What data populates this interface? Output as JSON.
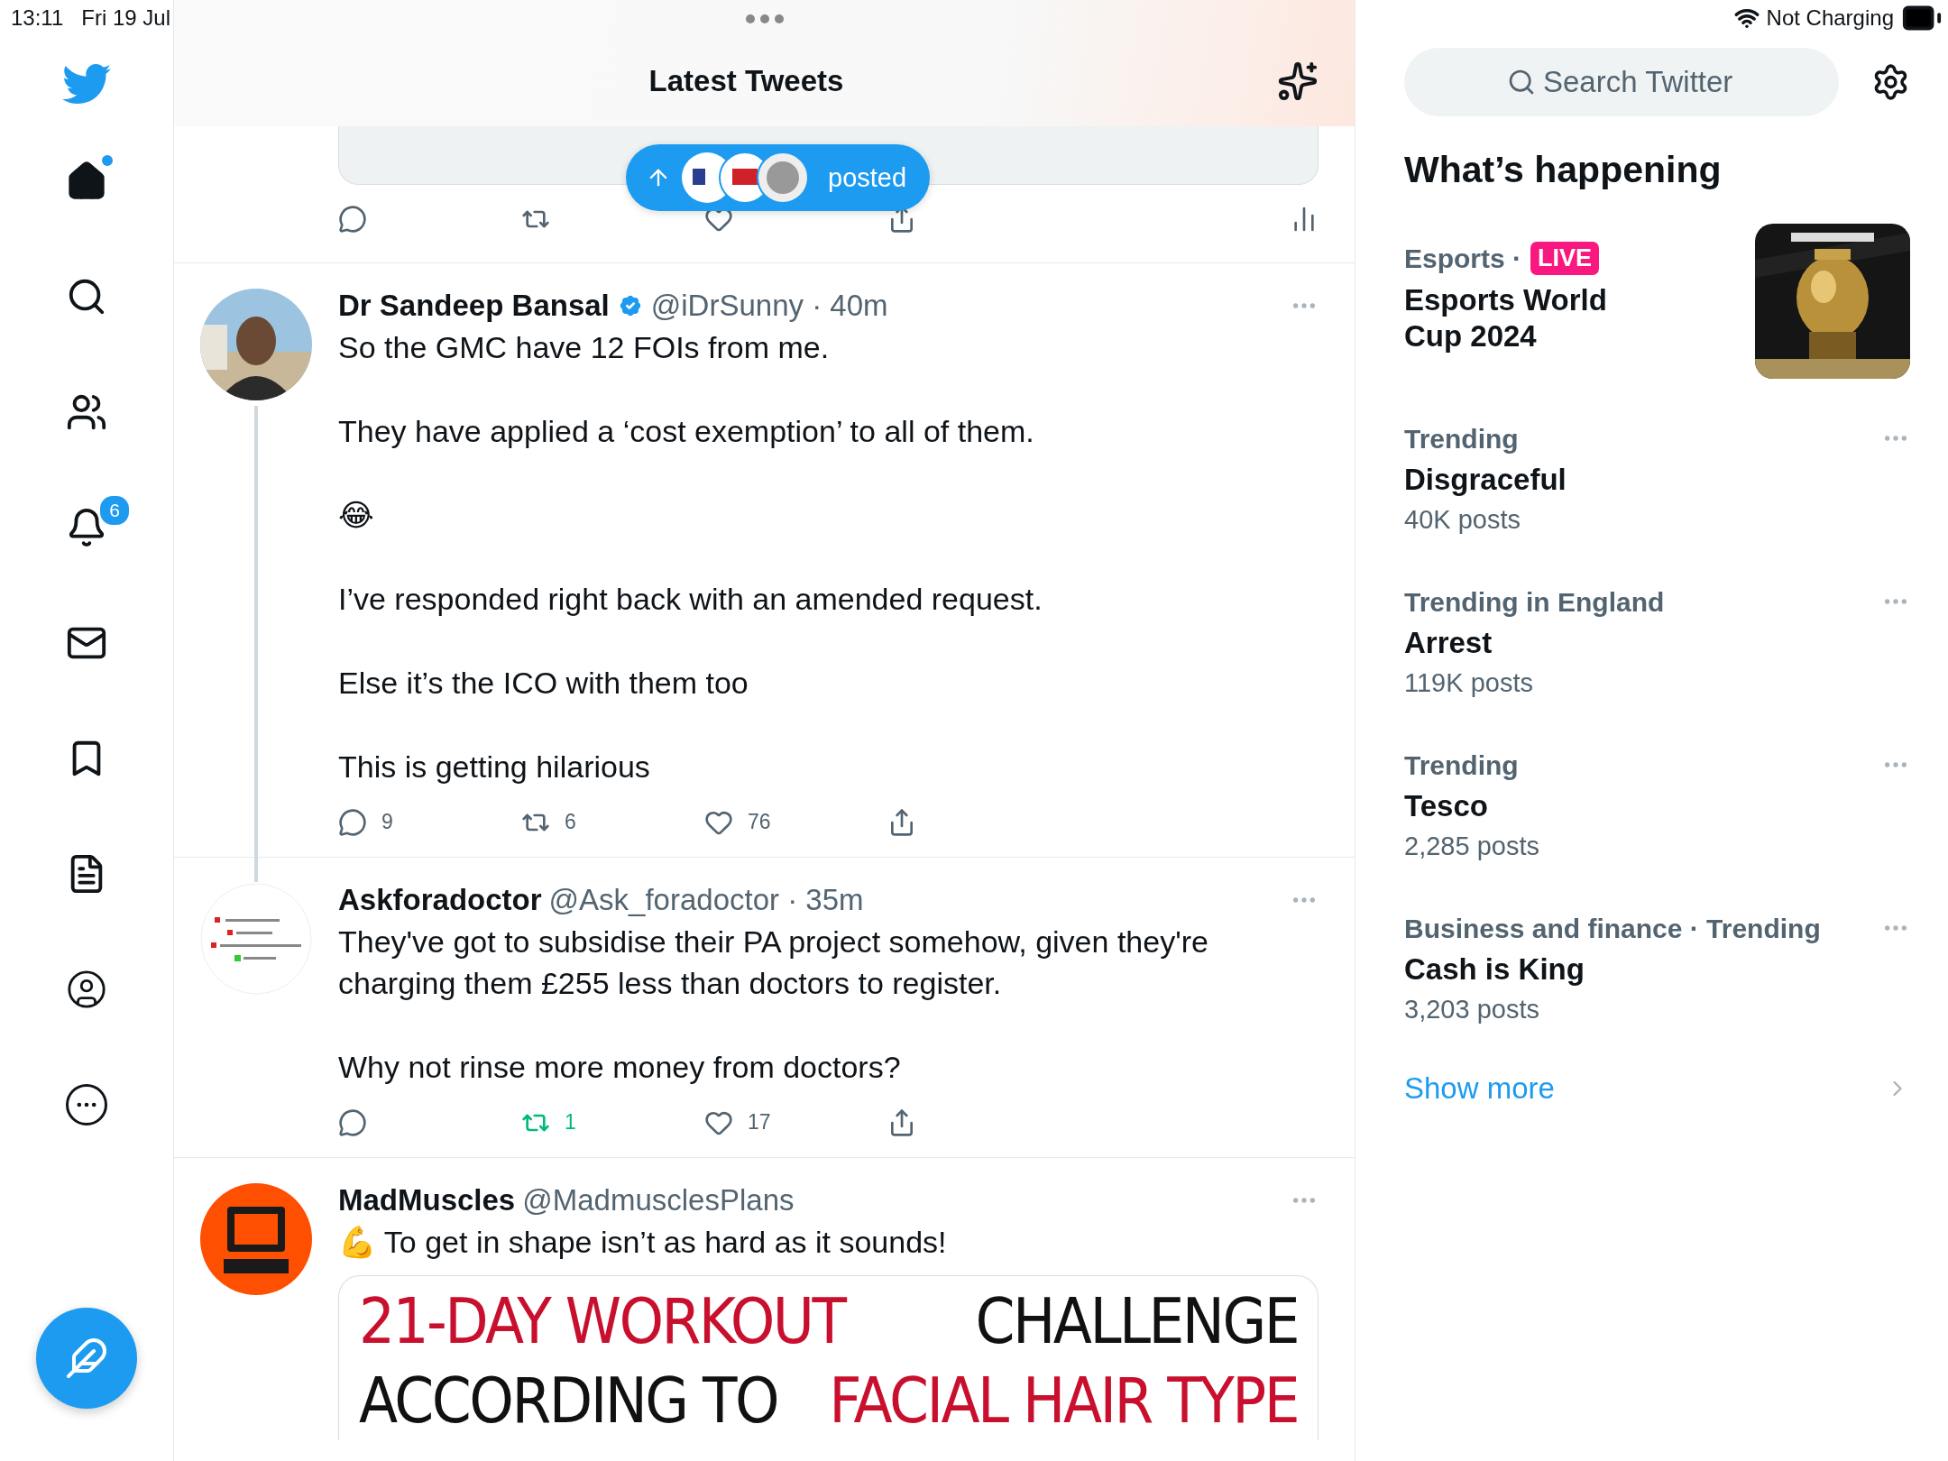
{
  "status_bar": {
    "time": "13:11",
    "date": "Fri 19 Jul",
    "charging": "Not Charging"
  },
  "sidebar": {
    "items": [
      {
        "kind": "home",
        "selected": true,
        "dot": true
      },
      {
        "kind": "search",
        "selected": false
      },
      {
        "kind": "communities",
        "selected": false
      },
      {
        "kind": "notifications",
        "selected": false,
        "badge": "6"
      },
      {
        "kind": "messages",
        "selected": false
      },
      {
        "kind": "bookmarks",
        "selected": false
      },
      {
        "kind": "lists",
        "selected": false
      },
      {
        "kind": "profile",
        "selected": false
      },
      {
        "kind": "more",
        "selected": false
      }
    ]
  },
  "header": {
    "title": "Latest Tweets"
  },
  "new_posts_pill": {
    "label": "posted"
  },
  "previous_tweet": {
    "actions": [
      {
        "kind": "reply"
      },
      {
        "kind": "retweet"
      },
      {
        "kind": "like"
      },
      {
        "kind": "share"
      },
      {
        "kind": "views"
      }
    ]
  },
  "tweets": [
    {
      "kind": "person",
      "name": "Dr Sandeep Bansal",
      "verified": true,
      "handle": "@iDrSunny · 40m",
      "thread": true,
      "text": "So the GMC have 12 FOIs from me.\n\nThey have applied a ‘cost exemption’ to all of them.\n\n😂\n\nI’ve responded right back with an amended request.\n\nElse it’s the ICO with them too\n\nThis is getting hilarious",
      "actions": [
        {
          "kind": "reply",
          "count": "9",
          "active": false
        },
        {
          "kind": "retweet",
          "count": "6",
          "active": false
        },
        {
          "kind": "like",
          "count": "76",
          "active": false
        },
        {
          "kind": "share",
          "active": false
        }
      ]
    },
    {
      "kind": "badge",
      "name": "Askforadoctor",
      "verified": false,
      "handle": "@Ask_foradoctor · 35m",
      "thread": false,
      "text": "They've got to subsidise their PA project somehow, given they're charging them £255 less than doctors to register.\n\nWhy not rinse more money from doctors?",
      "actions": [
        {
          "kind": "reply",
          "active": false
        },
        {
          "kind": "retweet",
          "count": "1",
          "active": true
        },
        {
          "kind": "like",
          "count": "17",
          "active": false
        },
        {
          "kind": "share",
          "active": false
        }
      ]
    },
    {
      "kind": "logo",
      "name": "MadMuscles",
      "verified": false,
      "handle": "@MadmusclesPlans",
      "thread": false,
      "text": "💪 To get in shape isn’t as hard as it sounds!",
      "media_lines": [
        [
          {
            "text": "21-DAY WORKOUT",
            "accent": true
          },
          {
            "text": "CHALLENGE",
            "accent": false
          }
        ],
        [
          {
            "text": "ACCORDING TO",
            "accent": false
          },
          {
            "text": "FACIAL HAIR TYPE",
            "accent": true
          }
        ]
      ]
    }
  ],
  "search": {
    "placeholder": "Search Twitter"
  },
  "trends_title": "What’s happening",
  "trends": [
    {
      "kind": "event",
      "category": "Esports ·",
      "badge": "LIVE",
      "title": "Esports World Cup 2024"
    },
    {
      "kind": "trend",
      "category": "Trending",
      "title": "Disgraceful",
      "posts": "40K posts"
    },
    {
      "kind": "trend",
      "category": "Trending in England",
      "title": "Arrest",
      "posts": "119K posts"
    },
    {
      "kind": "trend",
      "category": "Trending",
      "title": "Tesco",
      "posts": "2,285 posts"
    },
    {
      "kind": "trend",
      "category": "Business and finance · Trending",
      "title": "Cash is King",
      "posts": "3,203 posts"
    }
  ],
  "show_more": "Show more"
}
